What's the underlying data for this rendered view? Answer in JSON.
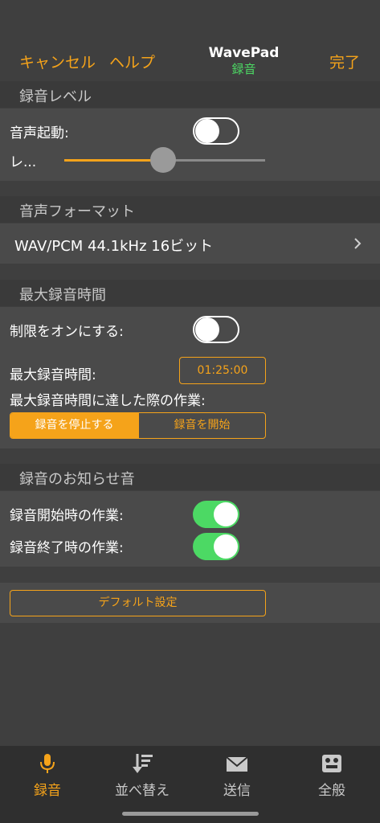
{
  "nav": {
    "cancel": "キャンセル",
    "help": "ヘルプ",
    "app_title": "WavePad",
    "subtitle": "録音",
    "done": "完了"
  },
  "recording_level": {
    "header": "録音レベル",
    "voice_activation_label": "音声起動:",
    "voice_activation_on": false,
    "level_label": "レ...",
    "level_value": 0.49
  },
  "audio_format": {
    "header": "音声フォーマット",
    "value": "WAV/PCM 44.1kHz 16ビット"
  },
  "max_recording": {
    "header": "最大録音時間",
    "limit_label": "制限をオンにする:",
    "limit_on": false,
    "time_label": "最大録音時間:",
    "time_value": "01:25:00",
    "action_label": "最大録音時間に達した際の作業:",
    "action_options": [
      "録音を停止する",
      "録音を開始"
    ],
    "action_selected": 0
  },
  "notification": {
    "header": "録音のお知らせ音",
    "start_label": "録音開始時の作業:",
    "start_on": true,
    "end_label": "録音終了時の作業:",
    "end_on": true
  },
  "defaults_button": "デフォルト設定",
  "tabs": [
    {
      "label": "録音",
      "icon": "microphone-icon",
      "active": true
    },
    {
      "label": "並べ替え",
      "icon": "sort-icon",
      "active": false
    },
    {
      "label": "送信",
      "icon": "envelope-icon",
      "active": false
    },
    {
      "label": "全般",
      "icon": "general-settings-icon",
      "active": false
    }
  ],
  "colors": {
    "accent": "#f5a31a",
    "toggle_on": "#4cd964",
    "background": "#3f3f3f",
    "group": "#4a4a4a"
  }
}
